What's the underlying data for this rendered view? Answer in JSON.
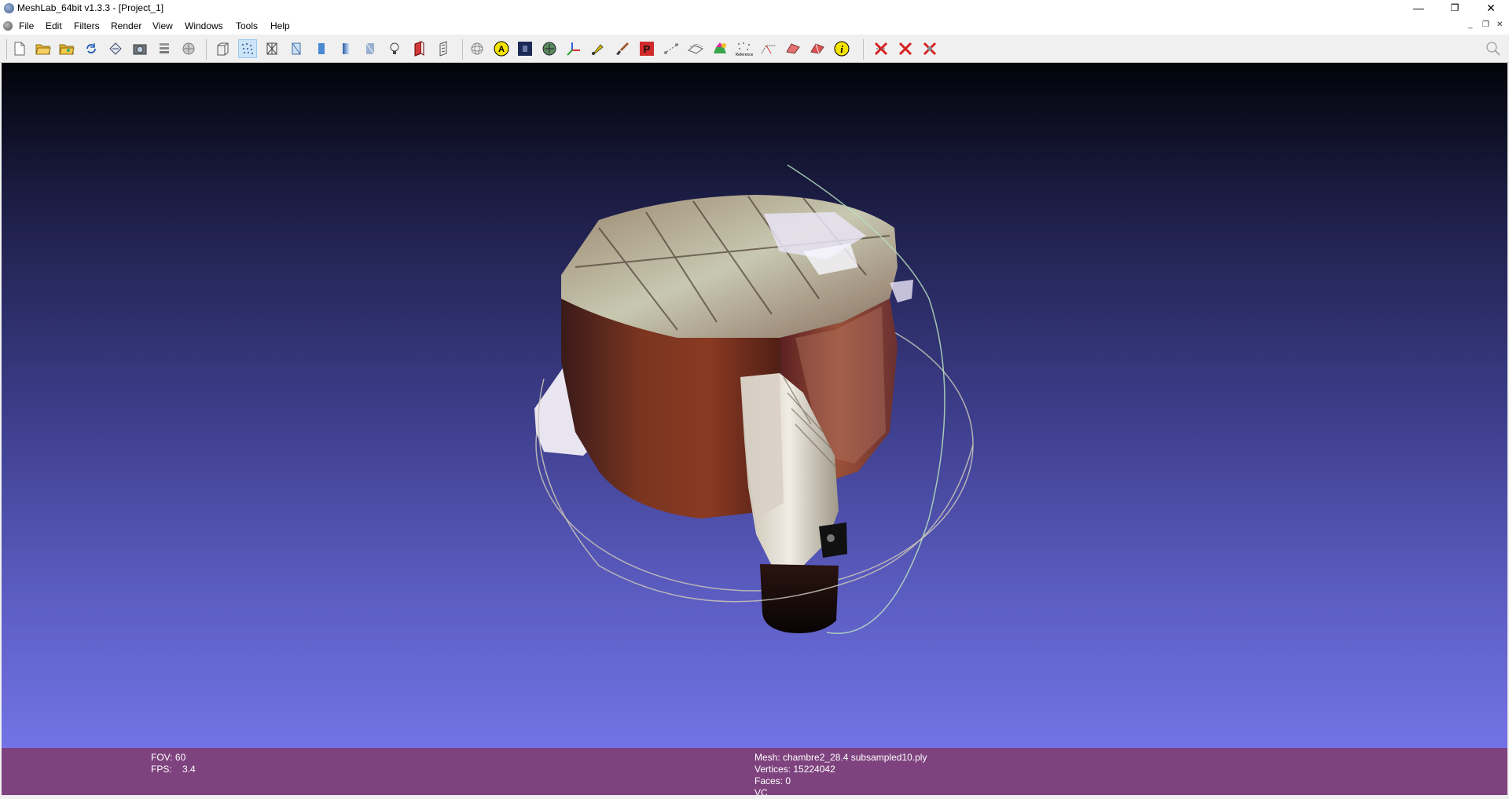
{
  "window": {
    "title": "MeshLab_64bit v1.3.3 - [Project_1]",
    "controls": {
      "minimize": "—",
      "restore": "❐",
      "close": "✕"
    }
  },
  "menu": {
    "items": [
      "File",
      "Edit",
      "Filters",
      "Render",
      "View",
      "Windows",
      "Tools",
      "Help"
    ],
    "mdi_controls": {
      "minimize": "_",
      "restore": "❐",
      "close": "✕"
    }
  },
  "toolbar": {
    "groups": [
      [
        "new-document-icon",
        "open-folder-icon",
        "open-project-icon",
        "reload-icon",
        "save-icon",
        "snapshot-icon",
        "layers-icon",
        "import-mesh-icon"
      ],
      [
        "bounding-box-icon",
        "points-render-icon",
        "wireframe-icon",
        "hidden-lines-icon",
        "flat-render-icon",
        "smooth-render-icon",
        "texture-render-icon",
        "light-icon",
        "double-side-lighting-icon",
        "back-face-icon"
      ],
      [
        "trackball-icon",
        "annotation-icon",
        "texture-icon",
        "decorate-icon",
        "axis-icon",
        "paint-icon",
        "brush-icon",
        "pick-points-icon",
        "measure-icon",
        "align-icon",
        "color-palette-icon",
        "reference-icon",
        "select-faces-icon",
        "select-vertices-icon",
        "select-connected-icon",
        "select-area-icon",
        "info-icon"
      ],
      [
        "delete-faces-icon",
        "delete-vertices-icon",
        "delete-selected-icon"
      ]
    ],
    "selected": "points-render-icon",
    "search_icon": "search-icon"
  },
  "viewport": {
    "background_top": "#03030a",
    "background_bottom": "#7373e6",
    "trackball_color": "#c9c4b8"
  },
  "status": {
    "fov_label": "FOV:",
    "fov_value": "60",
    "fps_label": "FPS:",
    "fps_value": "3.4",
    "mesh": "Mesh: chambre2_28.4 subsampled10.ply",
    "vertices": "Vertices: 15224042",
    "faces": "Faces: 0",
    "vc": "VC",
    "background": "#7e437e"
  }
}
